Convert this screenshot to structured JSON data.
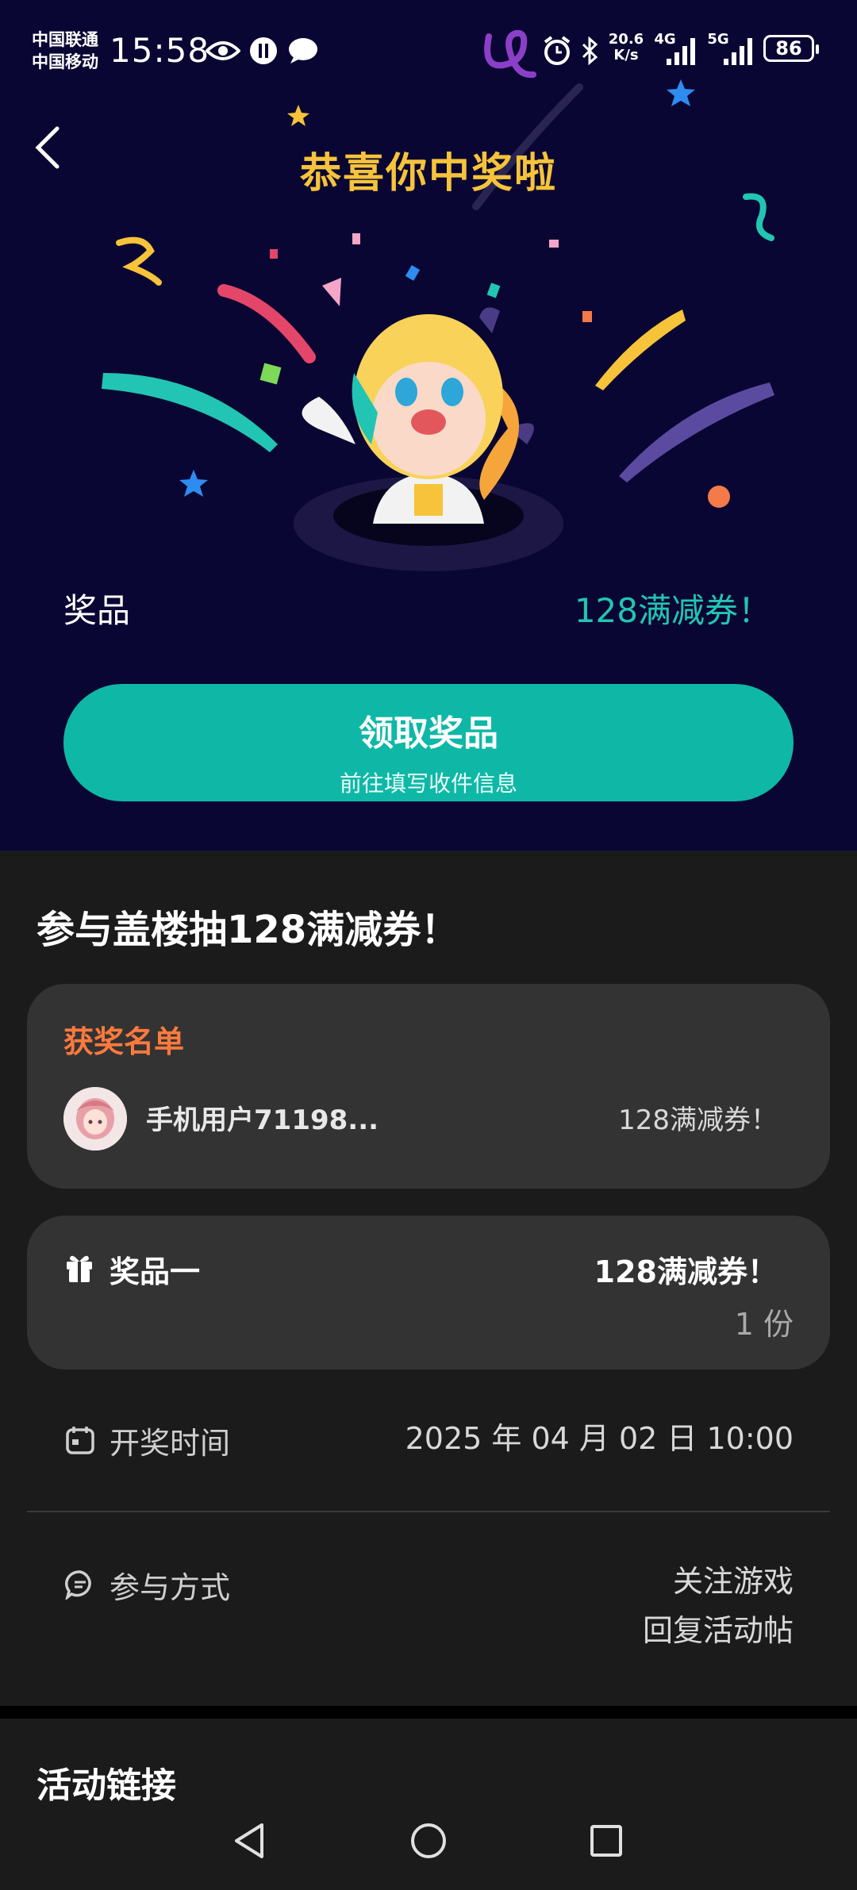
{
  "status_bar": {
    "carrier1": "中国联通",
    "carrier2": "中国移动",
    "time": "15:58",
    "net_speed_top": "20.6",
    "net_speed_bottom": "K/s",
    "net_4g": "4G",
    "net_5g": "5G",
    "battery": "86",
    "icons": [
      "eye-icon",
      "app-icon",
      "chat-icon",
      "alarm-icon",
      "bluetooth-icon",
      "signal-icon"
    ]
  },
  "hero": {
    "title": "恭喜你中奖啦",
    "prize_label": "奖品",
    "prize_value": "128满减券！",
    "claim_button": {
      "label": "领取奖品",
      "sublabel": "前往填写收件信息"
    },
    "colors": {
      "background": "#0a0633",
      "title": "#f6c33a",
      "accent": "#0fb8a6"
    }
  },
  "activity": {
    "title": "参与盖楼抽128满减券！",
    "winners": {
      "heading": "获奖名单",
      "list": [
        {
          "name": "手机用户71198...",
          "prize": "128满减券！"
        }
      ]
    },
    "prize_item": {
      "label": "奖品一",
      "value": "128满减券！",
      "count": "1 份"
    },
    "draw_time": {
      "label": "开奖时间",
      "value": "2025 年 04 月 02 日 10:00"
    },
    "participation": {
      "label": "参与方式",
      "methods": [
        "关注游戏",
        "回复活动帖"
      ]
    }
  },
  "links_section": {
    "title": "活动链接"
  }
}
